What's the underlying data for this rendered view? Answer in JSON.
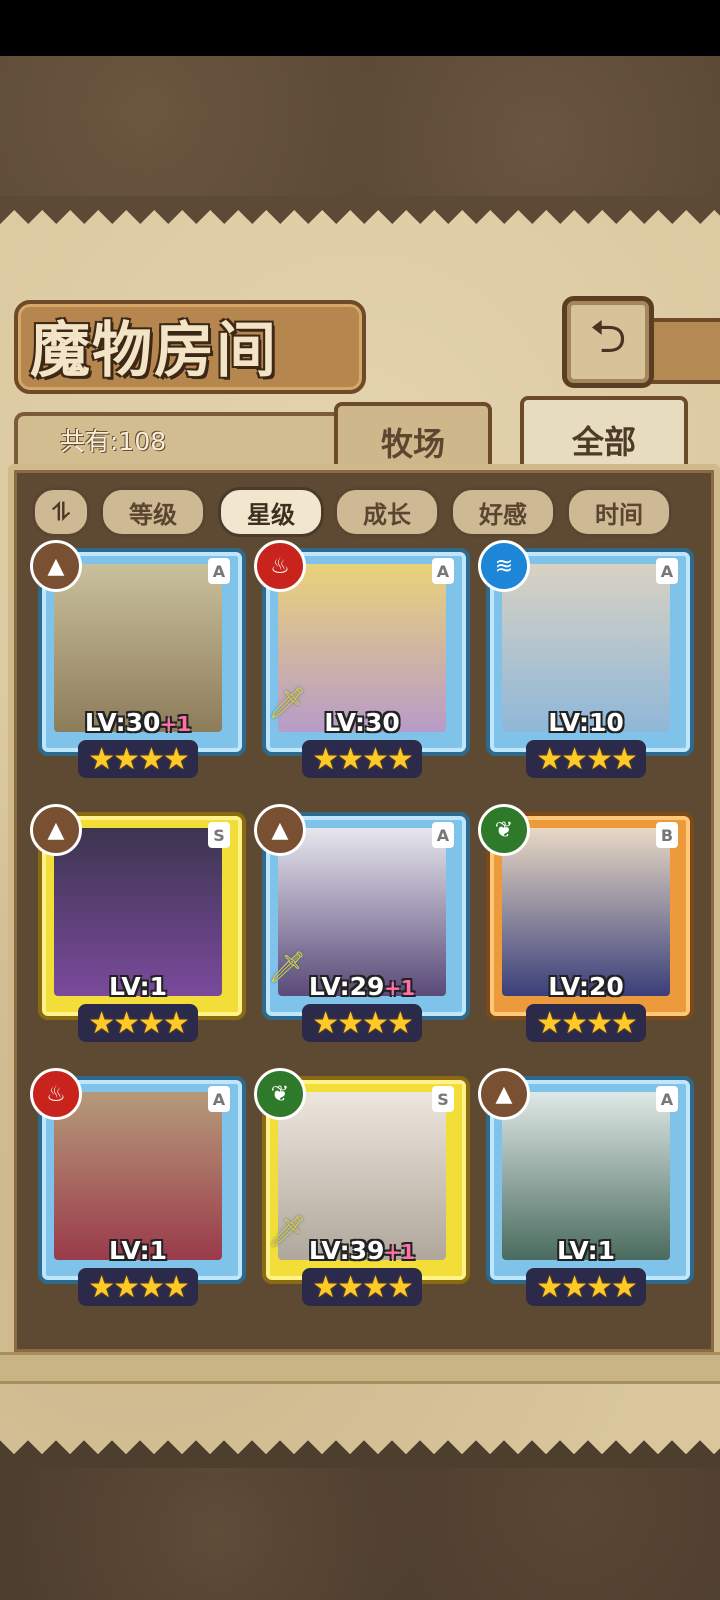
{
  "header": {
    "title": "魔物房间",
    "back_icon": "back-arrow-icon"
  },
  "summary": {
    "count_text": "共有:108"
  },
  "tabs": [
    {
      "label": "牧场",
      "selected": false
    },
    {
      "label": "全部",
      "selected": true
    }
  ],
  "sort": {
    "toggle_label": "⥮",
    "buttons": [
      {
        "label": "等级",
        "active": false
      },
      {
        "label": "星级",
        "active": true
      },
      {
        "label": "成长",
        "active": false
      },
      {
        "label": "好感",
        "active": false
      },
      {
        "label": "时间",
        "active": false
      }
    ]
  },
  "monsters": [
    {
      "element": "earth",
      "element_icon": "mountain-icon",
      "rank": "A",
      "level": "LV:30",
      "plus": "+1",
      "stars": "★★★★",
      "equipped": false
    },
    {
      "element": "fire",
      "element_icon": "flame-icon",
      "rank": "A",
      "level": "LV:30",
      "plus": "",
      "stars": "★★★★",
      "equipped": true
    },
    {
      "element": "water",
      "element_icon": "water-waves-icon",
      "rank": "A",
      "level": "LV:10",
      "plus": "",
      "stars": "★★★★",
      "equipped": false
    },
    {
      "element": "earth",
      "element_icon": "mountain-icon",
      "rank": "S",
      "level": "LV:1",
      "plus": "",
      "stars": "★★★★",
      "equipped": false
    },
    {
      "element": "earth",
      "element_icon": "mountain-icon",
      "rank": "A",
      "level": "LV:29",
      "plus": "+1",
      "stars": "★★★★",
      "equipped": true
    },
    {
      "element": "wood",
      "element_icon": "leaf-icon",
      "rank": "B",
      "level": "LV:20",
      "plus": "",
      "stars": "★★★★",
      "equipped": false
    },
    {
      "element": "fire",
      "element_icon": "flame-icon",
      "rank": "A",
      "level": "LV:1",
      "plus": "",
      "stars": "★★★★",
      "equipped": false
    },
    {
      "element": "wood",
      "element_icon": "leaf-icon",
      "rank": "S",
      "level": "LV:39",
      "plus": "+1",
      "stars": "★★★★",
      "equipped": true
    },
    {
      "element": "earth",
      "element_icon": "mountain-icon",
      "rank": "A",
      "level": "LV:1",
      "plus": "",
      "stars": "★★★★",
      "equipped": false
    }
  ]
}
